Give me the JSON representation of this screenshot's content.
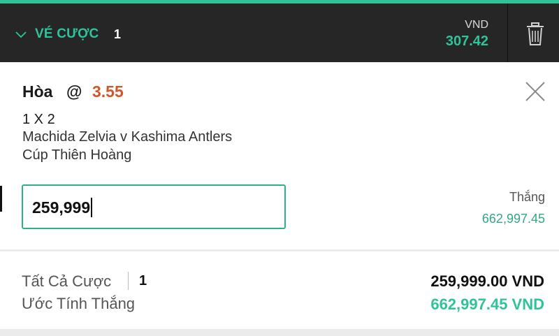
{
  "header": {
    "title": "VÉ CƯỢC",
    "count": "1",
    "currency": "VND",
    "balance": "307.42"
  },
  "bet": {
    "selection": "Hòa",
    "at": "@",
    "odds": "3.55",
    "market": "1 X 2",
    "event": "Machida Zelvia v Kashima Antlers",
    "competition": "Cúp Thiên Hoàng",
    "stake": "259,999",
    "win_label": "Thắng",
    "win_amount": "662,997.45"
  },
  "summary": {
    "total_bets_label": "Tất Cả Cược",
    "total_bets_count": "1",
    "total_stake": "259,999.00 VND",
    "estimated_win_label": "Ước Tính Thắng",
    "estimated_win": "662,997.45 VND"
  },
  "colors": {
    "accent": "#2fc39a",
    "odds": "#d2562a",
    "header_bg": "#262626"
  },
  "icons": [
    "chevron-down-icon",
    "trash-icon",
    "close-icon"
  ]
}
